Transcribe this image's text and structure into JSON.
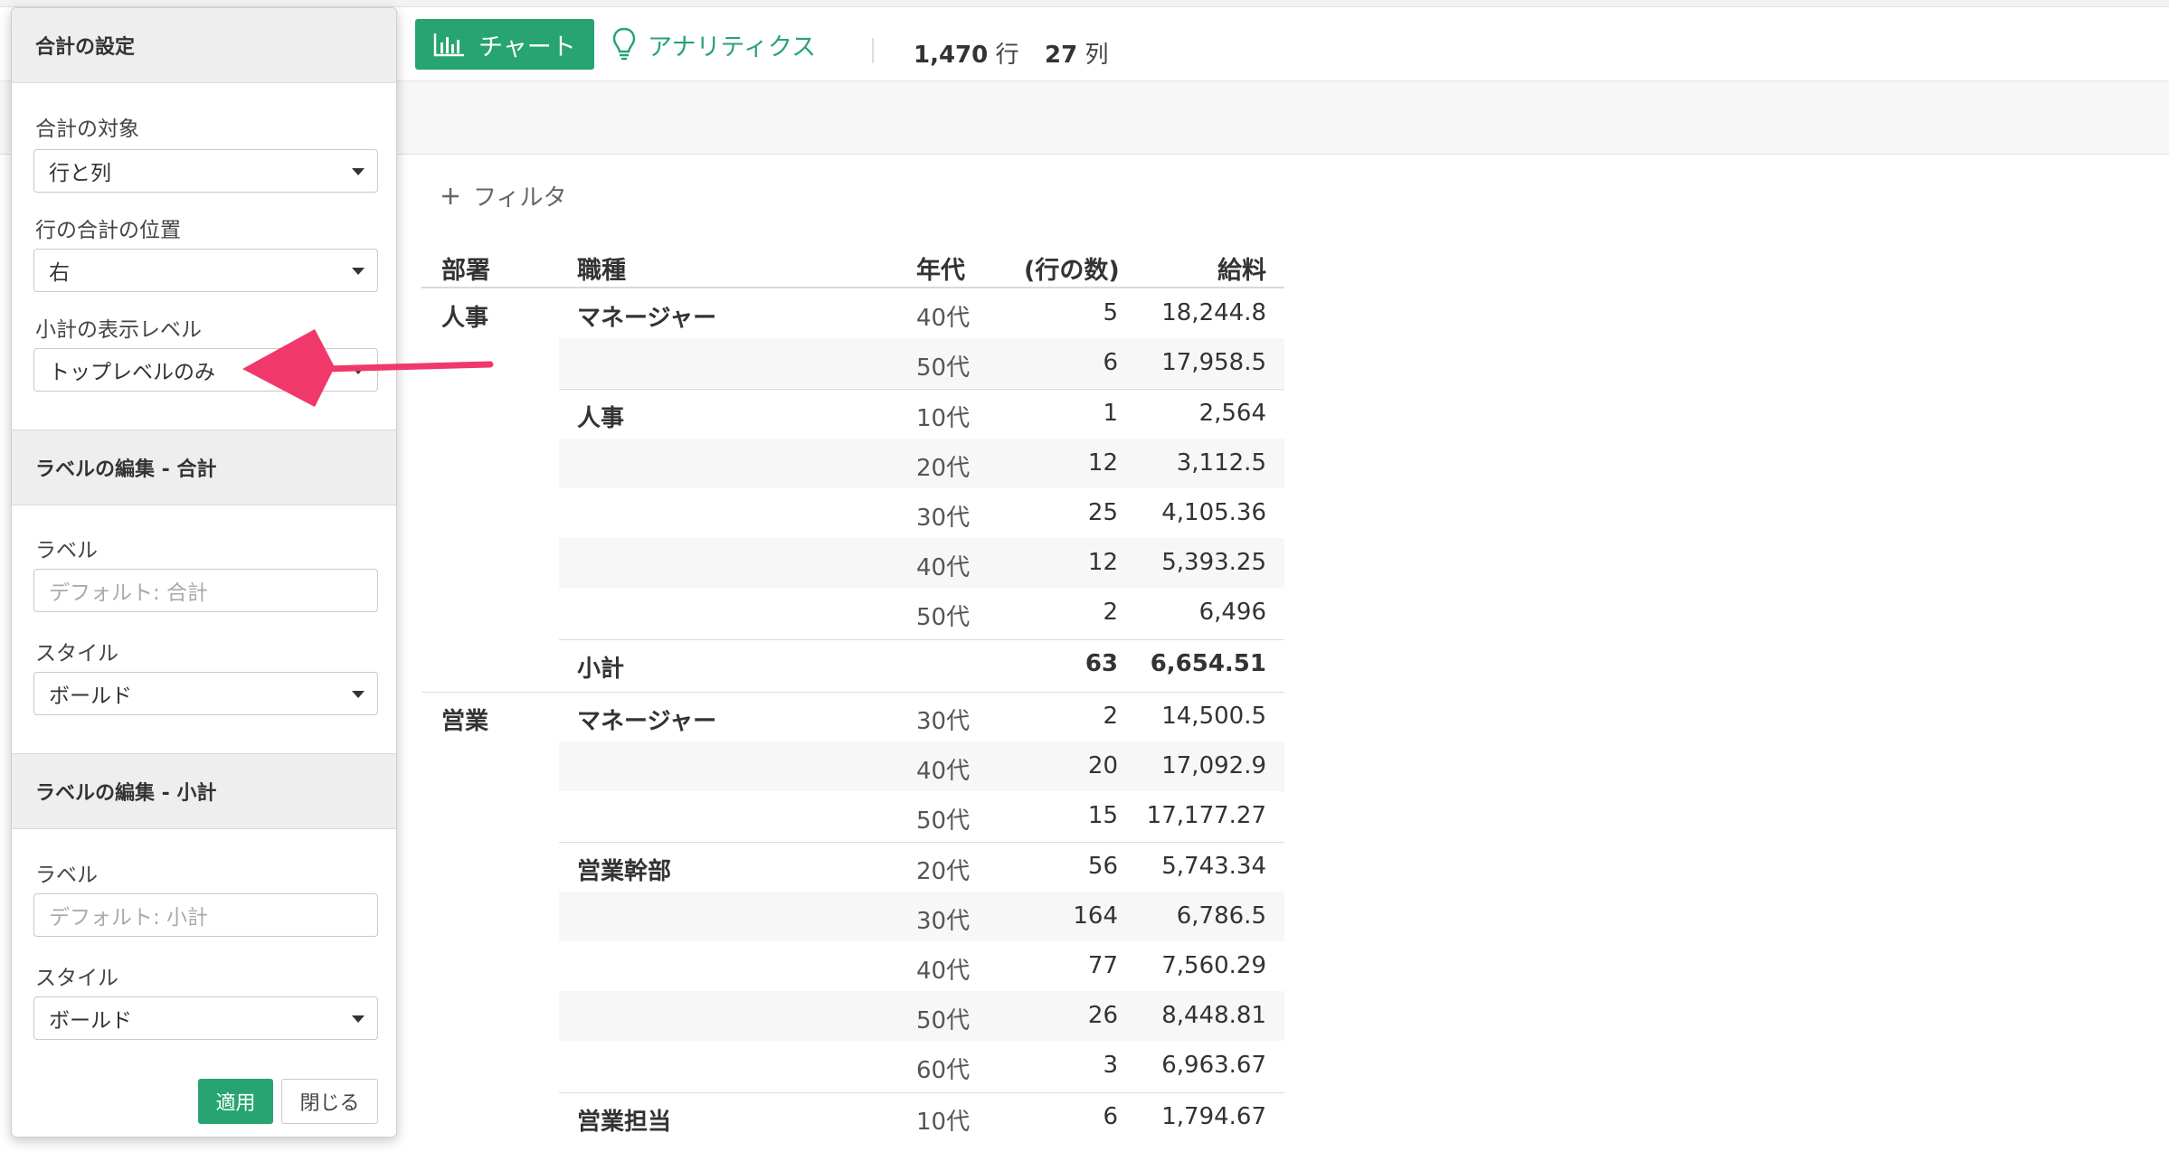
{
  "toolbar": {
    "chart_label": "チャート",
    "analytics_label": "アナリティクス",
    "rows_count": "1,470",
    "rows_unit": "行",
    "cols_count": "27",
    "cols_unit": "列"
  },
  "filter": {
    "label": "フィルタ"
  },
  "table": {
    "headers": [
      "部署",
      "職種",
      "年代",
      "(行の数)",
      "給料"
    ],
    "rows": [
      {
        "dept": "人事",
        "job": "マネージャー",
        "age": "40代",
        "count": "5",
        "salary": "18,244.8"
      },
      {
        "dept": "",
        "job": "",
        "age": "50代",
        "count": "6",
        "salary": "17,958.5"
      },
      {
        "dept": "",
        "job": "人事",
        "age": "10代",
        "count": "1",
        "salary": "2,564"
      },
      {
        "dept": "",
        "job": "",
        "age": "20代",
        "count": "12",
        "salary": "3,112.5"
      },
      {
        "dept": "",
        "job": "",
        "age": "30代",
        "count": "25",
        "salary": "4,105.36"
      },
      {
        "dept": "",
        "job": "",
        "age": "40代",
        "count": "12",
        "salary": "5,393.25"
      },
      {
        "dept": "",
        "job": "",
        "age": "50代",
        "count": "2",
        "salary": "6,496"
      },
      {
        "dept": "",
        "job": "小計",
        "age": "",
        "count": "63",
        "salary": "6,654.51"
      },
      {
        "dept": "営業",
        "job": "マネージャー",
        "age": "30代",
        "count": "2",
        "salary": "14,500.5"
      },
      {
        "dept": "",
        "job": "",
        "age": "40代",
        "count": "20",
        "salary": "17,092.9"
      },
      {
        "dept": "",
        "job": "",
        "age": "50代",
        "count": "15",
        "salary": "17,177.27"
      },
      {
        "dept": "",
        "job": "営業幹部",
        "age": "20代",
        "count": "56",
        "salary": "5,743.34"
      },
      {
        "dept": "",
        "job": "",
        "age": "30代",
        "count": "164",
        "salary": "6,786.5"
      },
      {
        "dept": "",
        "job": "",
        "age": "40代",
        "count": "77",
        "salary": "7,560.29"
      },
      {
        "dept": "",
        "job": "",
        "age": "50代",
        "count": "26",
        "salary": "8,448.81"
      },
      {
        "dept": "",
        "job": "",
        "age": "60代",
        "count": "3",
        "salary": "6,963.67"
      },
      {
        "dept": "",
        "job": "営業担当",
        "age": "10代",
        "count": "6",
        "salary": "1,794.67"
      }
    ]
  },
  "panel": {
    "title": "合計の設定",
    "target_label": "合計の対象",
    "target_value": "行と列",
    "row_total_pos_label": "行の合計の位置",
    "row_total_pos_value": "右",
    "subtotal_level_label": "小計の表示レベル",
    "subtotal_level_value": "トップレベルのみ",
    "total_section_title": "ラベルの編集 - 合計",
    "total_label_label": "ラベル",
    "total_label_placeholder": "デフォルト: 合計",
    "total_style_label": "スタイル",
    "total_style_value": "ボールド",
    "subtotal_section_title": "ラベルの編集 - 小計",
    "subtotal_label_label": "ラベル",
    "subtotal_label_placeholder": "デフォルト: 小計",
    "subtotal_style_label": "スタイル",
    "subtotal_style_value": "ボールド",
    "apply_label": "適用",
    "close_label": "閉じる"
  },
  "colors": {
    "accent": "#27a472",
    "arrow": "#f0386b"
  }
}
